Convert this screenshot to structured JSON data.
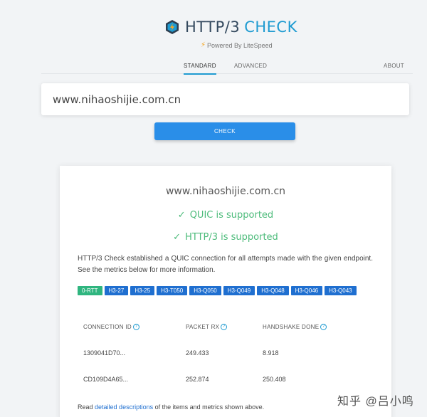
{
  "brand": {
    "title_a": "HTTP/3",
    "title_b": "CHECK",
    "powered": "Powered By LiteSpeed"
  },
  "nav": {
    "tabs": [
      "STANDARD",
      "ADVANCED"
    ],
    "about": "ABOUT"
  },
  "search": {
    "value": "www.nihaoshijie.com.cn"
  },
  "check_label": "CHECK",
  "result": {
    "domain": "www.nihaoshijie.com.cn",
    "quic": "QUIC is supported",
    "http3": "HTTP/3 is supported",
    "tick": "✓",
    "description": "HTTP/3 Check established a QUIC connection for all attempts made with the given endpoint. See the metrics below for more information.",
    "badges": [
      "0-RTT",
      "H3-27",
      "H3-25",
      "H3-T050",
      "H3-Q050",
      "H3-Q049",
      "H3-Q048",
      "H3-Q046",
      "H3-Q043"
    ],
    "columns": [
      "CONNECTION ID",
      "PACKET RX",
      "HANDSHAKE DONE"
    ],
    "rows": [
      [
        "1309041D70...",
        "249.433",
        "8.918"
      ],
      [
        "CD109D4A65...",
        "252.874",
        "250.408"
      ]
    ],
    "read_prefix": "Read",
    "read_link": "detailed descriptions",
    "read_suffix": "of the items and metrics shown above."
  },
  "watermark": "知乎 @吕小鸣",
  "colors": {
    "accent": "#1f9bd1",
    "button": "#2a8ee8",
    "success": "#4cbb7a",
    "badge": "#1f6fd0",
    "badge_green": "#2fb57f"
  }
}
